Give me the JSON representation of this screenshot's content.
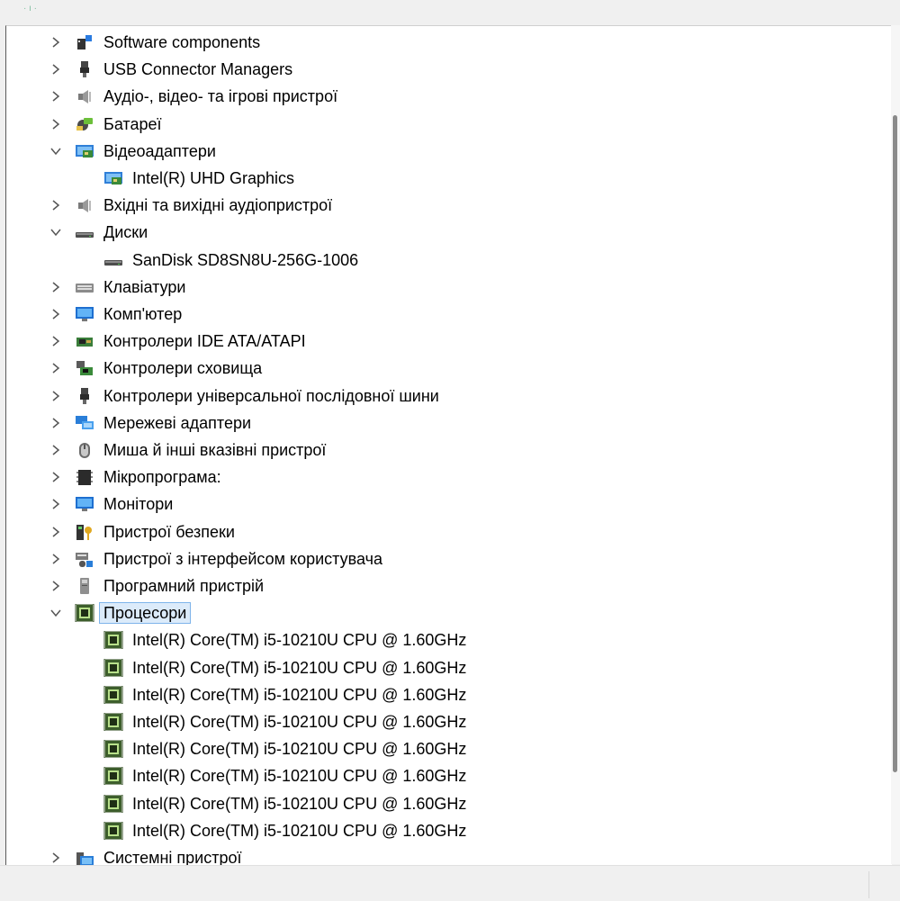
{
  "tree": [
    {
      "label": "Software components",
      "icon": "software-components-icon",
      "level": 1,
      "chevron": "collapsed"
    },
    {
      "label": "USB Connector Managers",
      "icon": "usb-plug-icon",
      "level": 1,
      "chevron": "collapsed"
    },
    {
      "label": "Аудіо-, відео- та ігрові пристрої",
      "icon": "speaker-icon",
      "level": 1,
      "chevron": "collapsed"
    },
    {
      "label": "Батареї",
      "icon": "battery-icon",
      "level": 1,
      "chevron": "collapsed"
    },
    {
      "label": "Відеоадаптери",
      "icon": "display-adapter-icon",
      "level": 1,
      "chevron": "expanded"
    },
    {
      "label": "Intel(R) UHD Graphics",
      "icon": "display-adapter-icon",
      "level": 2,
      "chevron": "none"
    },
    {
      "label": "Вхідні та вихідні аудіопристрої",
      "icon": "speaker-icon",
      "level": 1,
      "chevron": "collapsed"
    },
    {
      "label": "Диски",
      "icon": "disk-drive-icon",
      "level": 1,
      "chevron": "expanded"
    },
    {
      "label": "SanDisk SD8SN8U-256G-1006",
      "icon": "disk-drive-icon",
      "level": 2,
      "chevron": "none"
    },
    {
      "label": "Клавіатури",
      "icon": "keyboard-icon",
      "level": 1,
      "chevron": "collapsed"
    },
    {
      "label": "Комп'ютер",
      "icon": "computer-monitor-icon",
      "level": 1,
      "chevron": "collapsed"
    },
    {
      "label": "Контролери IDE ATA/ATAPI",
      "icon": "ide-controller-icon",
      "level": 1,
      "chevron": "collapsed"
    },
    {
      "label": "Контролери сховища",
      "icon": "storage-controller-icon",
      "level": 1,
      "chevron": "collapsed"
    },
    {
      "label": "Контролери універсальної послідовної шини",
      "icon": "usb-plug-icon",
      "level": 1,
      "chevron": "collapsed"
    },
    {
      "label": "Мережеві адаптери",
      "icon": "network-adapter-icon",
      "level": 1,
      "chevron": "collapsed"
    },
    {
      "label": "Миша й інші вказівні пристрої",
      "icon": "mouse-icon",
      "level": 1,
      "chevron": "collapsed"
    },
    {
      "label": "Мікропрограма:",
      "icon": "firmware-chip-icon",
      "level": 1,
      "chevron": "collapsed"
    },
    {
      "label": "Монітори",
      "icon": "computer-monitor-icon",
      "level": 1,
      "chevron": "collapsed"
    },
    {
      "label": "Пристрої безпеки",
      "icon": "security-key-icon",
      "level": 1,
      "chevron": "collapsed"
    },
    {
      "label": "Пристрої з інтерфейсом користувача",
      "icon": "hid-device-icon",
      "level": 1,
      "chevron": "collapsed"
    },
    {
      "label": "Програмний пристрій",
      "icon": "software-device-icon",
      "level": 1,
      "chevron": "collapsed"
    },
    {
      "label": "Процесори",
      "icon": "processor-icon",
      "level": 1,
      "chevron": "expanded",
      "selected": true
    },
    {
      "label": "Intel(R) Core(TM) i5-10210U CPU @ 1.60GHz",
      "icon": "processor-icon",
      "level": 2,
      "chevron": "none"
    },
    {
      "label": "Intel(R) Core(TM) i5-10210U CPU @ 1.60GHz",
      "icon": "processor-icon",
      "level": 2,
      "chevron": "none"
    },
    {
      "label": "Intel(R) Core(TM) i5-10210U CPU @ 1.60GHz",
      "icon": "processor-icon",
      "level": 2,
      "chevron": "none"
    },
    {
      "label": "Intel(R) Core(TM) i5-10210U CPU @ 1.60GHz",
      "icon": "processor-icon",
      "level": 2,
      "chevron": "none"
    },
    {
      "label": "Intel(R) Core(TM) i5-10210U CPU @ 1.60GHz",
      "icon": "processor-icon",
      "level": 2,
      "chevron": "none"
    },
    {
      "label": "Intel(R) Core(TM) i5-10210U CPU @ 1.60GHz",
      "icon": "processor-icon",
      "level": 2,
      "chevron": "none"
    },
    {
      "label": "Intel(R) Core(TM) i5-10210U CPU @ 1.60GHz",
      "icon": "processor-icon",
      "level": 2,
      "chevron": "none"
    },
    {
      "label": "Intel(R) Core(TM) i5-10210U CPU @ 1.60GHz",
      "icon": "processor-icon",
      "level": 2,
      "chevron": "none"
    },
    {
      "label": "Системні пристрої",
      "icon": "system-devices-icon",
      "level": 1,
      "chevron": "collapsed"
    }
  ],
  "colors": {
    "selection_bg": "#dcebfa",
    "selection_border": "#7eb4ea",
    "chevron": "#555555"
  }
}
